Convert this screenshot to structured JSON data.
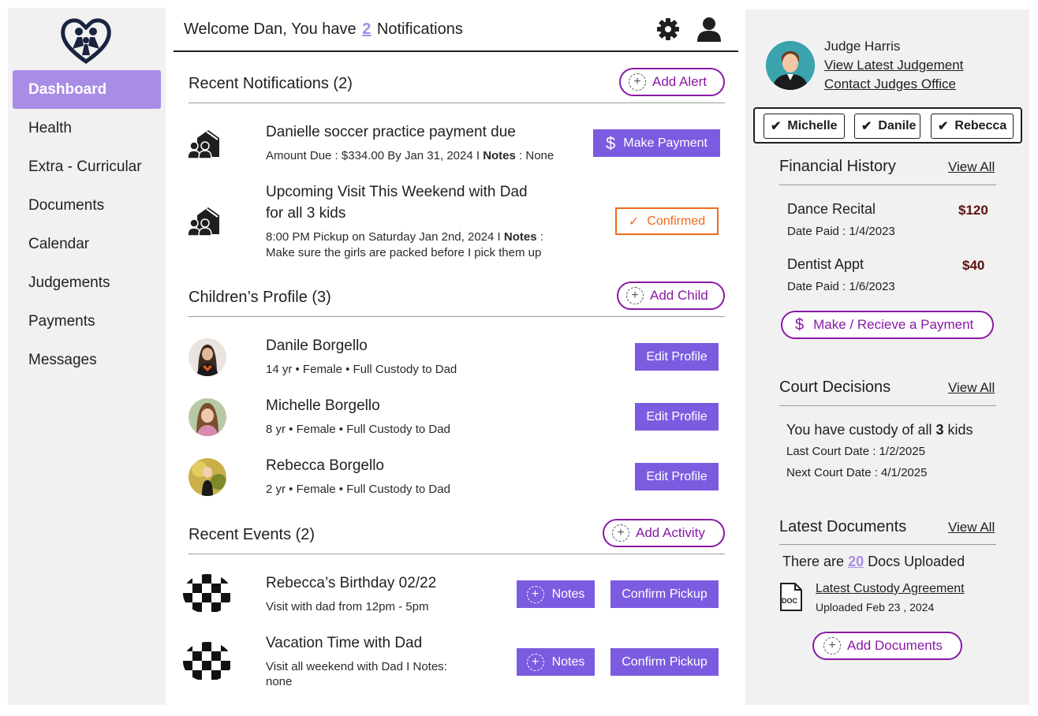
{
  "header": {
    "welcome_prefix": "Welcome Dan, You have",
    "notification_count": "2",
    "welcome_suffix": "Notifications"
  },
  "sidebar": {
    "items": [
      {
        "label": "Dashboard",
        "active": true
      },
      {
        "label": "Health"
      },
      {
        "label": "Extra - Curricular"
      },
      {
        "label": "Documents"
      },
      {
        "label": "Calendar"
      },
      {
        "label": "Judgements"
      },
      {
        "label": "Payments"
      },
      {
        "label": "Messages"
      }
    ]
  },
  "notifications": {
    "title": "Recent Notifications (2)",
    "add_label": "Add Alert",
    "items": [
      {
        "title": "Danielle soccer practice payment due",
        "sub_prefix": "Amount Due : $334.00 By Jan 31, 2024 I ",
        "notes_label": "Notes",
        "sub_suffix": " : None",
        "action": "Make Payment"
      },
      {
        "title_line1": "Upcoming Visit This Weekend with Dad",
        "title_line2": "for all 3 kids",
        "sub_prefix": "8:00 PM Pickup on Saturday Jan 2nd, 2024  I ",
        "notes_label": "Notes",
        "sub_suffix": " :",
        "sub_line2": "Make sure the girls are packed before I pick them up",
        "action": "Confirmed"
      }
    ]
  },
  "children": {
    "title": "Children’s Profile (3)",
    "add_label": "Add Child",
    "edit_label": "Edit Profile",
    "items": [
      {
        "name": "Danile Borgello",
        "details": "14 yr •  Female • Full Custody to Dad"
      },
      {
        "name": "Michelle Borgello",
        "details": "8 yr •  Female • Full Custody to Dad"
      },
      {
        "name": "Rebecca Borgello",
        "details": "2 yr •  Female • Full Custody to Dad"
      }
    ]
  },
  "events": {
    "title": "Recent Events (2)",
    "add_label": "Add Activity",
    "notes_label": "Notes",
    "confirm_label": "Confirm Pickup",
    "items": [
      {
        "title": "Rebecca’s Birthday 02/22",
        "sub_line1": "Visit with dad from 12pm - 5pm"
      },
      {
        "title": "Vacation Time with Dad",
        "sub_line1": "Visit all weekend with Dad I Notes:",
        "sub_line2": "none"
      }
    ]
  },
  "judge": {
    "name": "Judge Harris",
    "link1": "View Latest Judgement",
    "link2": "Contact Judges Office"
  },
  "kid_filter": [
    "Michelle",
    "Danile",
    "Rebecca"
  ],
  "financial": {
    "title": "Financial History",
    "view_all": "View All",
    "items": [
      {
        "title": "Dance Recital",
        "amount": "$120",
        "date": "Date Paid : 1/4/2023"
      },
      {
        "title": "Dentist Appt",
        "amount": "$40",
        "date": "Date Paid : 1/6/2023"
      }
    ],
    "pay_label": "Make / Recieve a Payment"
  },
  "court": {
    "title": "Court Decisions",
    "view_all": "View All",
    "custody_prefix": "You have custody of all",
    "custody_count": "3",
    "custody_suffix": "kids",
    "last_date": "Last Court Date : 1/2/2025",
    "next_date": "Next Court Date : 4/1/2025"
  },
  "documents": {
    "title": "Latest Documents",
    "view_all": "View All",
    "count_prefix": "There are",
    "count": "20",
    "count_suffix": "Docs Uploaded",
    "latest_name": "Latest Custody Agreement",
    "latest_date": "Uploaded Feb 23 , 2024",
    "doc_badge": "DOC",
    "add_label": "Add Documents"
  },
  "colors": {
    "accent_purple": "#7b5ce0",
    "active_nav": "#a98ce6",
    "pill_border": "#8a19a6",
    "confirmed_orange": "#f06a1d",
    "amount_red": "#5a1111"
  }
}
